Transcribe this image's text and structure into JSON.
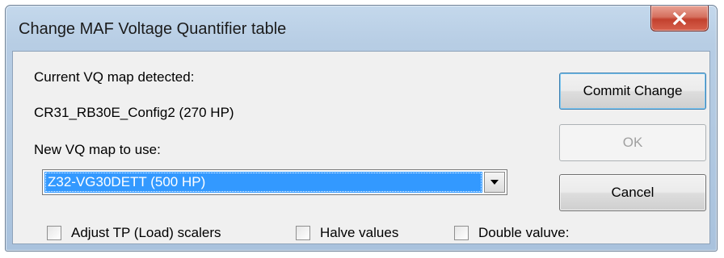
{
  "window": {
    "title": "Change MAF Voltage Quantifier table",
    "close_glyph": "X"
  },
  "labels": {
    "current_map_label": "Current VQ map detected:",
    "current_map_value": "CR31_RB30E_Config2 (270 HP)",
    "new_map_label": "New VQ map to use:"
  },
  "dropdown": {
    "selected": "Z32-VG30DETT (500 HP)"
  },
  "buttons": {
    "commit": "Commit Change",
    "ok": "OK",
    "cancel": "Cancel"
  },
  "checkboxes": [
    {
      "label": "Adjust TP (Load) scalers",
      "checked": false
    },
    {
      "label": "Halve values",
      "checked": false
    },
    {
      "label": "Double valuve:",
      "checked": false
    }
  ],
  "icons": {
    "close": "close-icon",
    "dropdown": "chevron-down-icon"
  }
}
